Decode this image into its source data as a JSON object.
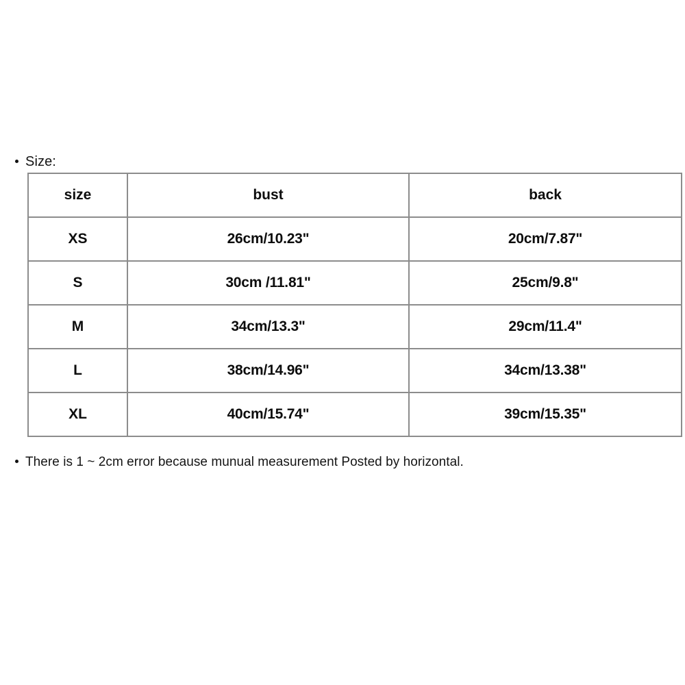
{
  "size_section": {
    "label": "Size:",
    "bullet": "•"
  },
  "table": {
    "columns": [
      "size",
      "bust",
      "back"
    ],
    "rows": [
      {
        "size": "XS",
        "bust": "26cm/10.23\"",
        "back": "20cm/7.87\""
      },
      {
        "size": "S",
        "bust": "30cm /11.81\"",
        "back": "25cm/9.8\""
      },
      {
        "size": "M",
        "bust": "34cm/13.3\"",
        "back": "29cm/11.4\""
      },
      {
        "size": "L",
        "bust": "38cm/14.96\"",
        "back": "34cm/13.38\""
      },
      {
        "size": "XL",
        "bust": "40cm/15.74\"",
        "back": "39cm/15.35\""
      }
    ],
    "border_color": "#8c8c8c",
    "text_color": "#0d0d0d",
    "background": "#ffffff"
  },
  "note": {
    "bullet": "•",
    "text": "There is 1 ~ 2cm error because munual measurement Posted by horizontal."
  }
}
